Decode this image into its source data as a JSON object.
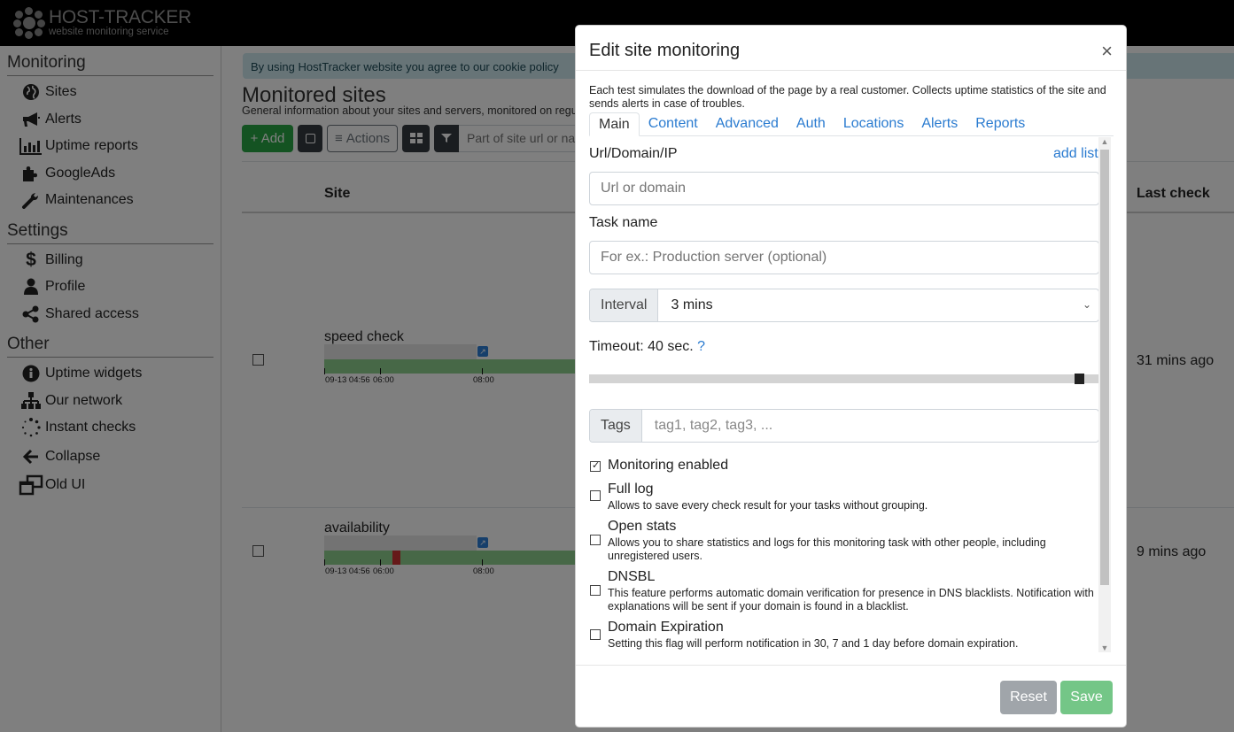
{
  "header": {
    "logo_title": "HOST-TRACKER",
    "logo_subtitle": "website monitoring service"
  },
  "sidebar": {
    "sections": [
      {
        "title": "Monitoring",
        "items": [
          {
            "label": "Sites",
            "icon": "globe-icon"
          },
          {
            "label": "Alerts",
            "icon": "megaphone-icon"
          },
          {
            "label": "Uptime reports",
            "icon": "bar-chart-icon"
          },
          {
            "label": "GoogleAds",
            "icon": "puzzle-icon"
          },
          {
            "label": "Maintenances",
            "icon": "wrench-icon"
          }
        ]
      },
      {
        "title": "Settings",
        "items": [
          {
            "label": "Billing",
            "icon": "dollar-icon"
          },
          {
            "label": "Profile",
            "icon": "user-icon"
          },
          {
            "label": "Shared access",
            "icon": "share-icon"
          }
        ]
      },
      {
        "title": "Other",
        "items": [
          {
            "label": "Uptime widgets",
            "icon": "info-icon"
          },
          {
            "label": "Our network",
            "icon": "sitemap-icon"
          },
          {
            "label": "Instant checks",
            "icon": "spinner-icon"
          },
          {
            "label": "Collapse",
            "icon": "arrow-left-icon"
          },
          {
            "label": "Old UI",
            "icon": "window-restore-icon"
          }
        ]
      }
    ]
  },
  "main": {
    "cookie_notice": "By using HostTracker website you agree to our cookie policy",
    "title": "Monitored sites",
    "subtitle": "General information about your sites and servers, monitored on regular basis",
    "toolbar": {
      "add_label": "+ Add",
      "actions_label": "Actions",
      "filter_placeholder": "Part of site url or name"
    },
    "table": {
      "headers": {
        "site": "Site",
        "last_check": "Last check"
      },
      "rows": [
        {
          "name": "speed check",
          "last_check": "31 mins ago",
          "timeline_labels": [
            "09-13 04:56",
            "06:00",
            "08:00"
          ],
          "has_failure": false
        },
        {
          "name": "availability",
          "last_check": "9 mins ago",
          "timeline_labels": [
            "09-13 04:56",
            "06:00",
            "08:00"
          ],
          "has_failure": true
        }
      ]
    }
  },
  "modal": {
    "title": "Edit site monitoring",
    "close_label": "×",
    "description": "Each test simulates the download of the page by a real customer. Collects uptime statistics of the site and sends alerts in case of troubles.",
    "tabs": [
      {
        "label": "Main",
        "active": true
      },
      {
        "label": "Content"
      },
      {
        "label": "Advanced"
      },
      {
        "label": "Auth"
      },
      {
        "label": "Locations"
      },
      {
        "label": "Alerts"
      },
      {
        "label": "Reports"
      }
    ],
    "url_label": "Url/Domain/IP",
    "add_list_label": "add list",
    "url_placeholder": "Url or domain",
    "url_value": "",
    "task_name_label": "Task name",
    "task_name_placeholder": "For ex.: Production server (optional)",
    "task_name_value": "",
    "interval_label": "Interval",
    "interval_value": "3 mins",
    "timeout_label": "Timeout: 40 sec.",
    "timeout_help": "?",
    "timeout_slider_fraction": 0.97,
    "tags_label": "Tags",
    "tags_placeholder": "tag1, tag2, tag3, ...",
    "options": [
      {
        "title": "Monitoring enabled",
        "desc": "",
        "checked": true
      },
      {
        "title": "Full log",
        "desc": "Allows to save every check result for your tasks without grouping.",
        "checked": false
      },
      {
        "title": "Open stats",
        "desc": "Allows you to share statistics and logs for this monitoring task with other people, including unregistered users.",
        "checked": false
      },
      {
        "title": "DNSBL",
        "desc": "This feature performs automatic domain verification for presence in DNS blacklists. Notification with explanations will be sent if your domain is found in a blacklist.",
        "checked": false
      },
      {
        "title": "Domain Expiration",
        "desc": "Setting this flag will perform notification in 30, 7 and 1 day before domain expiration.",
        "checked": false
      }
    ],
    "reset_label": "Reset",
    "save_label": "Save"
  }
}
